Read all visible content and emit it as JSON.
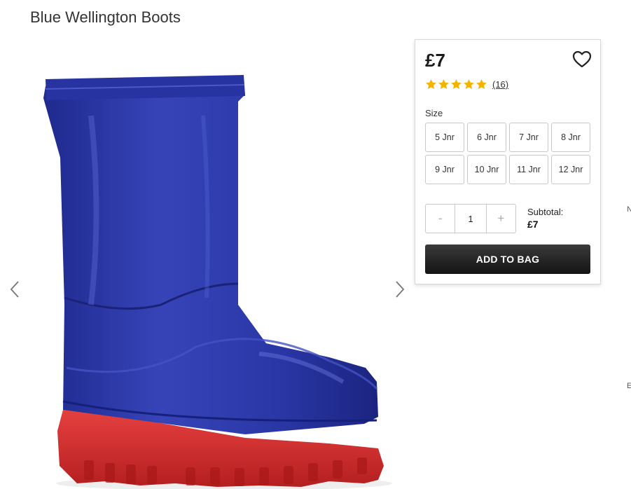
{
  "product": {
    "title": "Blue Wellington Boots",
    "price": "£7",
    "rating": {
      "stars": 5,
      "out_of": 5,
      "review_count": "(16)"
    }
  },
  "size": {
    "label": "Size",
    "options": [
      "5 Jnr",
      "6 Jnr",
      "7 Jnr",
      "8 Jnr",
      "9 Jnr",
      "10 Jnr",
      "11 Jnr",
      "12 Jnr"
    ]
  },
  "quantity": {
    "decrement": "-",
    "value": "1",
    "increment": "+"
  },
  "subtotal": {
    "label": "Subtotal:",
    "value": "£7"
  },
  "actions": {
    "add_to_bag": "ADD TO BAG"
  },
  "edge_text": {
    "top": "N",
    "bottom": "E"
  },
  "colors": {
    "boot_blue": "#2b36a8",
    "sole_red": "#d92e2e",
    "star_gold": "#f5b301",
    "button_dark": "#1e1e1e"
  },
  "icons": {
    "prev": "chevron-left-icon",
    "next": "chevron-right-icon",
    "wishlist": "heart-icon",
    "star": "star-icon"
  }
}
